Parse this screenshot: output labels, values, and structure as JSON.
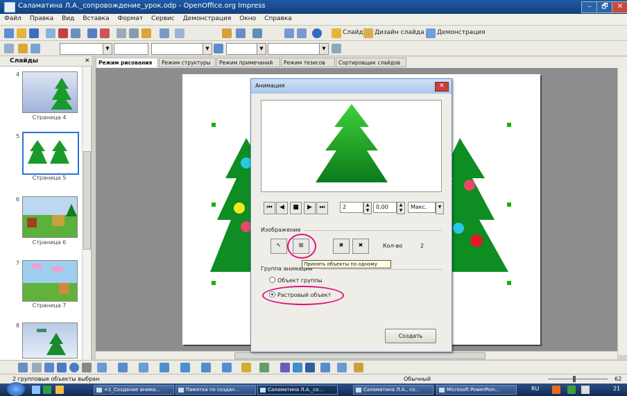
{
  "window": {
    "title": "Саламатина Л.А._сопровождение_урок.odp - OpenOffice.org Impress",
    "min": "–",
    "max": "🗗",
    "close": "✕"
  },
  "menu": [
    "Файл",
    "Правка",
    "Вид",
    "Вставка",
    "Формат",
    "Сервис",
    "Демонстрация",
    "Окно",
    "Справка"
  ],
  "toolbar": {
    "slide_label": "Слайд",
    "design_label": "Дизайн слайда",
    "show_label": "Демонстрация"
  },
  "slides_panel": {
    "title": "Слайды",
    "items": [
      {
        "num": "4",
        "label": "Страница 4"
      },
      {
        "num": "5",
        "label": "Страница 5"
      },
      {
        "num": "6",
        "label": "Страница 6"
      },
      {
        "num": "7",
        "label": "Страница 7"
      },
      {
        "num": "8",
        "label": ""
      }
    ]
  },
  "tabs": [
    "Режим рисования",
    "Режим структуры",
    "Режим примечаний",
    "Режим тезисов",
    "Сортировщик слайдов"
  ],
  "dialog": {
    "title": "Анимация",
    "close": "✕",
    "playback": {
      "first": "⏮",
      "prev": "◀",
      "stop": "■",
      "play": "▶",
      "last": "⏭",
      "frame": "2",
      "time": "0,00",
      "mode": "Макс."
    },
    "image_section": "Изображение",
    "count_label": "Кол-во",
    "count_value": "2",
    "group_section": "Группа анимации",
    "radio_group": "Объект группы",
    "radio_bitmap": "Растровый объект",
    "tooltip": "Принять объекты по одному",
    "create": "Создать"
  },
  "status": {
    "left": "2 групповые объекты выбран",
    "middle": "Обычный",
    "zoom": "62"
  },
  "taskbar": [
    "+1_Создание анима...",
    "Памятка по создан...",
    "Саламатина Л.А._со...",
    "Саламатина Л.А., со...",
    "Microsoft PowerPoin..."
  ],
  "tray": {
    "lang": "RU",
    "clock": "21"
  },
  "colors": {
    "tree_dark": "#0b7a1a",
    "tree_light": "#37c53a",
    "highlight_ring": "#e0127a"
  }
}
